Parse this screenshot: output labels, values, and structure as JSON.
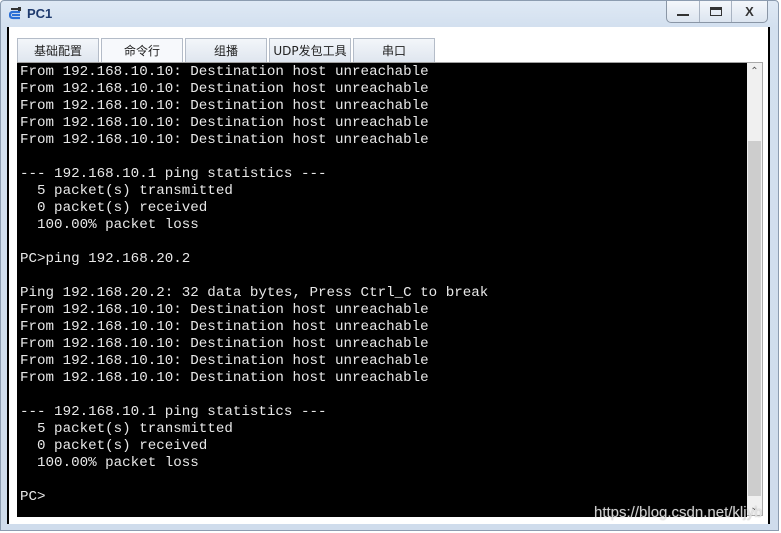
{
  "window": {
    "title": "PC1",
    "icon": "network-device-icon",
    "controls": {
      "minimize": "minimize",
      "maximize": "maximize",
      "close": "X"
    }
  },
  "tabs": [
    {
      "label": "基础配置",
      "active": false
    },
    {
      "label": "命令行",
      "active": true
    },
    {
      "label": "组播",
      "active": false
    },
    {
      "label": "UDP发包工具",
      "active": false
    },
    {
      "label": "串口",
      "active": false
    }
  ],
  "terminal": {
    "lines": [
      "From 192.168.10.10: Destination host unreachable",
      "From 192.168.10.10: Destination host unreachable",
      "From 192.168.10.10: Destination host unreachable",
      "From 192.168.10.10: Destination host unreachable",
      "From 192.168.10.10: Destination host unreachable",
      "",
      "--- 192.168.10.1 ping statistics ---",
      "  5 packet(s) transmitted",
      "  0 packet(s) received",
      "  100.00% packet loss",
      "",
      "PC>ping 192.168.20.2",
      "",
      "Ping 192.168.20.2: 32 data bytes, Press Ctrl_C to break",
      "From 192.168.10.10: Destination host unreachable",
      "From 192.168.10.10: Destination host unreachable",
      "From 192.168.10.10: Destination host unreachable",
      "From 192.168.10.10: Destination host unreachable",
      "From 192.168.10.10: Destination host unreachable",
      "",
      "--- 192.168.10.1 ping statistics ---",
      "  5 packet(s) transmitted",
      "  0 packet(s) received",
      "  100.00% packet loss",
      "",
      "PC>"
    ]
  },
  "scrollbar": {
    "up_glyph": "^",
    "down_glyph": "v",
    "position_fraction": 1.0
  },
  "watermark": "https://blog.csdn.net/kljyb",
  "colors": {
    "terminal_bg": "#000000",
    "terminal_fg": "#e8e8e8",
    "title_color": "#1e3a6e"
  }
}
